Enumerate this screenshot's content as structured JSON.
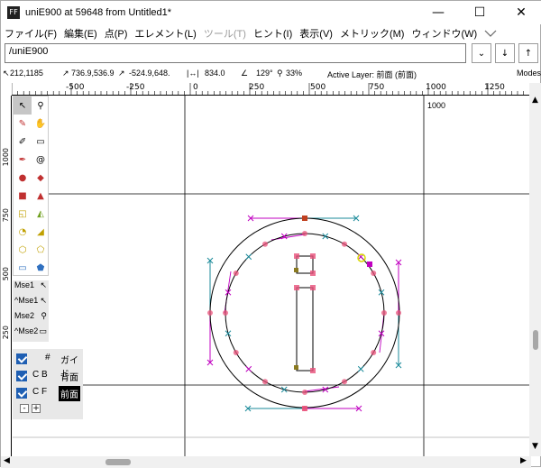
{
  "window": {
    "title": "uniE900 at 59648 from Untitled1*",
    "icon_label": "FF",
    "minimize": "—",
    "maximize": "☐",
    "close": "✕"
  },
  "menubar": {
    "items": [
      {
        "label": "ファイル(F)",
        "enabled": true
      },
      {
        "label": "編集(E)",
        "enabled": true
      },
      {
        "label": "点(P)",
        "enabled": true
      },
      {
        "label": "エレメント(L)",
        "enabled": true
      },
      {
        "label": "ツール(T)",
        "enabled": false
      },
      {
        "label": "ヒント(I)",
        "enabled": true
      },
      {
        "label": "表示(V)",
        "enabled": true
      },
      {
        "label": "メトリック(M)",
        "enabled": true
      },
      {
        "label": "ウィンドウ(W)",
        "enabled": true
      }
    ]
  },
  "path_bar": {
    "value": "/uniE900",
    "dropdown_glyph": "⌄",
    "prev_glyph": "↓",
    "next_glyph": "↑"
  },
  "info_bar": {
    "cursor_pos": "212,1185",
    "point_pos": "736.9,536.9",
    "delta_pos": "-524.9,648.",
    "distance": "834.0",
    "angle": "129°",
    "zoom": "33%",
    "active_layer": "Active Layer: 前面 (前面)",
    "modes": "Modes"
  },
  "ruler": {
    "top_labels": [
      "-500",
      "-250",
      "0",
      "250",
      "500",
      "750",
      "1000",
      "1250"
    ],
    "left_labels": [
      "1000",
      "750",
      "500",
      "250"
    ]
  },
  "canvas": {
    "advance_label": "1000"
  },
  "mouse_bindings": [
    "Mse1",
    "^Mse1",
    "Mse2",
    "^Mse2"
  ],
  "layers": {
    "header_symbol": "#",
    "rows": [
      {
        "code": "",
        "name": "ガイド",
        "checked": true,
        "selected": false
      },
      {
        "code": "C  B",
        "name": "背面",
        "checked": true,
        "selected": false
      },
      {
        "code": "C  F",
        "name": "前面",
        "checked": true,
        "selected": true
      }
    ],
    "remove_label": "-",
    "add_label": "+"
  },
  "colors": {
    "outline": "#000000",
    "control_line_magenta": "#c000c0",
    "control_line_teal": "#1a8a9a",
    "point_red": "#e8507a",
    "selected_point": "#d8d800",
    "canvas_bg": "#ffffff"
  }
}
